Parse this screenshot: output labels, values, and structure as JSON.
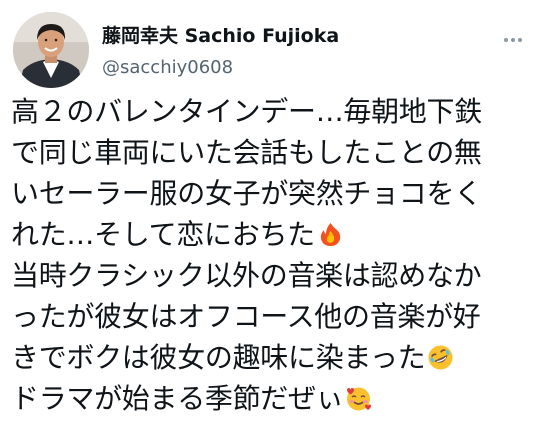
{
  "author": {
    "display_name": "藤岡幸夫 Sachio Fujioka",
    "handle": "@sacchiy0608"
  },
  "menu": {
    "icon": "more-dots-icon"
  },
  "tweet": {
    "lines": [
      "高２のバレンタインデー…毎朝地下鉄",
      "で同じ車両にいた会話もしたことの無",
      "いセーラー服の女子が突然チョコをく",
      "れた…そして恋におちた",
      "当時クラシック以外の音楽は認めなか",
      "ったが彼女はオフコース他の音楽が好",
      "きでボクは彼女の趣味に染まった",
      "ドラマが始まる季節だぜぃ"
    ],
    "emojis": [
      "fire-emoji",
      "rolling-laughing-emoji",
      "smiling-hearts-emoji"
    ]
  },
  "colors": {
    "text": "#0f1419",
    "secondary": "#536471",
    "background": "#ffffff"
  }
}
